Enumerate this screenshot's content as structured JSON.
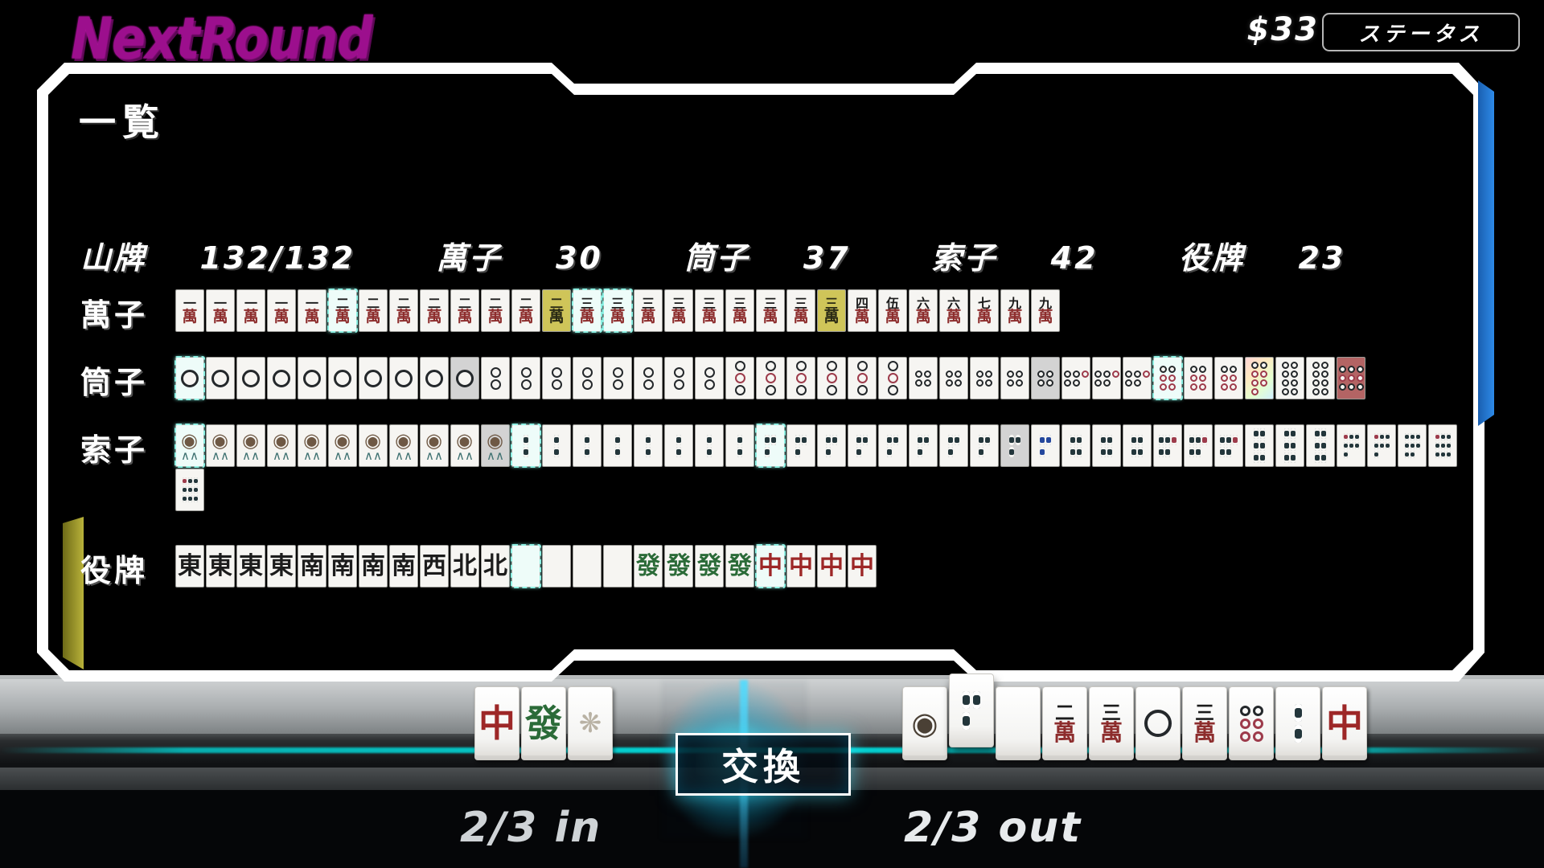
{
  "header": {
    "logo": "NextRound",
    "money": "$33",
    "status_button": "ステータス",
    "accent_magenta": "#9c0f8d"
  },
  "panel": {
    "title": "一覧",
    "counts": {
      "wall_label": "山牌",
      "wall_value": "132/132",
      "man_label": "萬子",
      "man_value": "30",
      "pin_label": "筒子",
      "pin_value": "37",
      "sou_label": "索子",
      "sou_value": "42",
      "honor_label": "役牌",
      "honor_value": "23"
    },
    "rows": [
      {
        "label": "萬子",
        "tiles": [
          {
            "k": "m",
            "n": "一",
            "hl": false,
            "bg": ""
          },
          {
            "k": "m",
            "n": "一",
            "hl": false,
            "bg": ""
          },
          {
            "k": "m",
            "n": "一",
            "hl": false,
            "bg": ""
          },
          {
            "k": "m",
            "n": "一",
            "hl": false,
            "bg": ""
          },
          {
            "k": "m",
            "n": "一",
            "hl": false,
            "bg": ""
          },
          {
            "k": "m",
            "n": "二",
            "hl": true,
            "bg": ""
          },
          {
            "k": "m",
            "n": "二",
            "hl": false,
            "bg": ""
          },
          {
            "k": "m",
            "n": "二",
            "hl": false,
            "bg": ""
          },
          {
            "k": "m",
            "n": "二",
            "hl": false,
            "bg": ""
          },
          {
            "k": "m",
            "n": "二",
            "hl": false,
            "bg": ""
          },
          {
            "k": "m",
            "n": "二",
            "hl": false,
            "bg": ""
          },
          {
            "k": "m",
            "n": "二",
            "hl": false,
            "bg": ""
          },
          {
            "k": "m",
            "n": "二",
            "hl": false,
            "bg": "yellow"
          },
          {
            "k": "m",
            "n": "三",
            "hl": true,
            "bg": ""
          },
          {
            "k": "m",
            "n": "三",
            "hl": true,
            "bg": ""
          },
          {
            "k": "m",
            "n": "三",
            "hl": false,
            "bg": ""
          },
          {
            "k": "m",
            "n": "三",
            "hl": false,
            "bg": ""
          },
          {
            "k": "m",
            "n": "三",
            "hl": false,
            "bg": ""
          },
          {
            "k": "m",
            "n": "三",
            "hl": false,
            "bg": ""
          },
          {
            "k": "m",
            "n": "三",
            "hl": false,
            "bg": ""
          },
          {
            "k": "m",
            "n": "三",
            "hl": false,
            "bg": ""
          },
          {
            "k": "m",
            "n": "三",
            "hl": false,
            "bg": "yellow"
          },
          {
            "k": "m",
            "n": "四",
            "hl": false,
            "bg": ""
          },
          {
            "k": "m",
            "n": "伍",
            "hl": false,
            "bg": ""
          },
          {
            "k": "m",
            "n": "六",
            "hl": false,
            "bg": ""
          },
          {
            "k": "m",
            "n": "六",
            "hl": false,
            "bg": ""
          },
          {
            "k": "m",
            "n": "七",
            "hl": false,
            "bg": ""
          },
          {
            "k": "m",
            "n": "九",
            "hl": false,
            "bg": ""
          },
          {
            "k": "m",
            "n": "九",
            "hl": false,
            "bg": ""
          }
        ]
      },
      {
        "label": "筒子",
        "tiles": [
          {
            "k": "p",
            "n": 1,
            "hl": true,
            "bg": ""
          },
          {
            "k": "p",
            "n": 1,
            "hl": false,
            "bg": ""
          },
          {
            "k": "p",
            "n": 1,
            "hl": false,
            "bg": ""
          },
          {
            "k": "p",
            "n": 1,
            "hl": false,
            "bg": ""
          },
          {
            "k": "p",
            "n": 1,
            "hl": false,
            "bg": ""
          },
          {
            "k": "p",
            "n": 1,
            "hl": false,
            "bg": ""
          },
          {
            "k": "p",
            "n": 1,
            "hl": false,
            "bg": ""
          },
          {
            "k": "p",
            "n": 1,
            "hl": false,
            "bg": ""
          },
          {
            "k": "p",
            "n": 1,
            "hl": false,
            "bg": ""
          },
          {
            "k": "p",
            "n": 1,
            "hl": false,
            "bg": "grey"
          },
          {
            "k": "p",
            "n": 2,
            "hl": false,
            "bg": ""
          },
          {
            "k": "p",
            "n": 2,
            "hl": false,
            "bg": ""
          },
          {
            "k": "p",
            "n": 2,
            "hl": false,
            "bg": ""
          },
          {
            "k": "p",
            "n": 2,
            "hl": false,
            "bg": ""
          },
          {
            "k": "p",
            "n": 2,
            "hl": false,
            "bg": ""
          },
          {
            "k": "p",
            "n": 2,
            "hl": false,
            "bg": ""
          },
          {
            "k": "p",
            "n": 2,
            "hl": false,
            "bg": ""
          },
          {
            "k": "p",
            "n": 2,
            "hl": false,
            "bg": ""
          },
          {
            "k": "p",
            "n": 3,
            "hl": false,
            "bg": ""
          },
          {
            "k": "p",
            "n": 3,
            "hl": false,
            "bg": ""
          },
          {
            "k": "p",
            "n": 3,
            "hl": false,
            "bg": ""
          },
          {
            "k": "p",
            "n": 3,
            "hl": false,
            "bg": ""
          },
          {
            "k": "p",
            "n": 3,
            "hl": false,
            "bg": ""
          },
          {
            "k": "p",
            "n": 3,
            "hl": false,
            "bg": ""
          },
          {
            "k": "p",
            "n": 4,
            "hl": false,
            "bg": ""
          },
          {
            "k": "p",
            "n": 4,
            "hl": false,
            "bg": ""
          },
          {
            "k": "p",
            "n": 4,
            "hl": false,
            "bg": ""
          },
          {
            "k": "p",
            "n": 4,
            "hl": false,
            "bg": ""
          },
          {
            "k": "p",
            "n": 4,
            "hl": false,
            "bg": "grey"
          },
          {
            "k": "p",
            "n": 5,
            "hl": false,
            "bg": ""
          },
          {
            "k": "p",
            "n": 5,
            "hl": false,
            "bg": ""
          },
          {
            "k": "p",
            "n": 5,
            "hl": false,
            "bg": ""
          },
          {
            "k": "p",
            "n": 6,
            "hl": true,
            "bg": ""
          },
          {
            "k": "p",
            "n": 6,
            "hl": false,
            "bg": ""
          },
          {
            "k": "p",
            "n": 6,
            "hl": false,
            "bg": ""
          },
          {
            "k": "p",
            "n": 7,
            "hl": false,
            "bg": "rainbow"
          },
          {
            "k": "p",
            "n": 8,
            "hl": false,
            "bg": ""
          },
          {
            "k": "p",
            "n": 8,
            "hl": false,
            "bg": ""
          },
          {
            "k": "p",
            "n": 9,
            "hl": false,
            "bg": "red"
          }
        ]
      },
      {
        "label": "索子",
        "tiles": [
          {
            "k": "s",
            "n": 1,
            "hl": true,
            "bg": ""
          },
          {
            "k": "s",
            "n": 1,
            "hl": false,
            "bg": ""
          },
          {
            "k": "s",
            "n": 1,
            "hl": false,
            "bg": ""
          },
          {
            "k": "s",
            "n": 1,
            "hl": false,
            "bg": ""
          },
          {
            "k": "s",
            "n": 1,
            "hl": false,
            "bg": ""
          },
          {
            "k": "s",
            "n": 1,
            "hl": false,
            "bg": ""
          },
          {
            "k": "s",
            "n": 1,
            "hl": false,
            "bg": ""
          },
          {
            "k": "s",
            "n": 1,
            "hl": false,
            "bg": ""
          },
          {
            "k": "s",
            "n": 1,
            "hl": false,
            "bg": ""
          },
          {
            "k": "s",
            "n": 1,
            "hl": false,
            "bg": ""
          },
          {
            "k": "s",
            "n": 1,
            "hl": false,
            "bg": "grey"
          },
          {
            "k": "s",
            "n": 2,
            "hl": true,
            "bg": ""
          },
          {
            "k": "s",
            "n": 2,
            "hl": false,
            "bg": ""
          },
          {
            "k": "s",
            "n": 2,
            "hl": false,
            "bg": ""
          },
          {
            "k": "s",
            "n": 2,
            "hl": false,
            "bg": ""
          },
          {
            "k": "s",
            "n": 2,
            "hl": false,
            "bg": ""
          },
          {
            "k": "s",
            "n": 2,
            "hl": false,
            "bg": ""
          },
          {
            "k": "s",
            "n": 2,
            "hl": false,
            "bg": ""
          },
          {
            "k": "s",
            "n": 2,
            "hl": false,
            "bg": ""
          },
          {
            "k": "s",
            "n": 3,
            "hl": true,
            "bg": ""
          },
          {
            "k": "s",
            "n": 3,
            "hl": false,
            "bg": ""
          },
          {
            "k": "s",
            "n": 3,
            "hl": false,
            "bg": ""
          },
          {
            "k": "s",
            "n": 3,
            "hl": false,
            "bg": ""
          },
          {
            "k": "s",
            "n": 3,
            "hl": false,
            "bg": ""
          },
          {
            "k": "s",
            "n": 3,
            "hl": false,
            "bg": ""
          },
          {
            "k": "s",
            "n": 3,
            "hl": false,
            "bg": ""
          },
          {
            "k": "s",
            "n": 3,
            "hl": false,
            "bg": ""
          },
          {
            "k": "s",
            "n": 3,
            "hl": false,
            "bg": "grey"
          },
          {
            "k": "s",
            "n": 3,
            "hl": false,
            "bg": "blue"
          },
          {
            "k": "s",
            "n": 4,
            "hl": false,
            "bg": ""
          },
          {
            "k": "s",
            "n": 4,
            "hl": false,
            "bg": ""
          },
          {
            "k": "s",
            "n": 4,
            "hl": false,
            "bg": ""
          },
          {
            "k": "s",
            "n": 5,
            "hl": false,
            "bg": ""
          },
          {
            "k": "s",
            "n": 5,
            "hl": false,
            "bg": ""
          },
          {
            "k": "s",
            "n": 5,
            "hl": false,
            "bg": ""
          },
          {
            "k": "s",
            "n": 6,
            "hl": false,
            "bg": ""
          },
          {
            "k": "s",
            "n": 6,
            "hl": false,
            "bg": ""
          },
          {
            "k": "s",
            "n": 6,
            "hl": false,
            "bg": ""
          },
          {
            "k": "s",
            "n": 7,
            "hl": false,
            "bg": ""
          },
          {
            "k": "s",
            "n": 7,
            "hl": false,
            "bg": ""
          },
          {
            "k": "s",
            "n": 8,
            "hl": false,
            "bg": ""
          },
          {
            "k": "s",
            "n": 9,
            "hl": false,
            "bg": ""
          },
          {
            "k": "s",
            "n": 9,
            "hl": false,
            "bg": ""
          }
        ]
      },
      {
        "label": "役牌",
        "tiles": [
          {
            "k": "h",
            "n": "東",
            "hl": false,
            "bg": ""
          },
          {
            "k": "h",
            "n": "東",
            "hl": false,
            "bg": ""
          },
          {
            "k": "h",
            "n": "東",
            "hl": false,
            "bg": ""
          },
          {
            "k": "h",
            "n": "東",
            "hl": false,
            "bg": ""
          },
          {
            "k": "h",
            "n": "南",
            "hl": false,
            "bg": ""
          },
          {
            "k": "h",
            "n": "南",
            "hl": false,
            "bg": ""
          },
          {
            "k": "h",
            "n": "南",
            "hl": false,
            "bg": ""
          },
          {
            "k": "h",
            "n": "南",
            "hl": false,
            "bg": ""
          },
          {
            "k": "h",
            "n": "西",
            "hl": false,
            "bg": ""
          },
          {
            "k": "h",
            "n": "北",
            "hl": false,
            "bg": ""
          },
          {
            "k": "h",
            "n": "北",
            "hl": false,
            "bg": ""
          },
          {
            "k": "h",
            "n": "",
            "hl": true,
            "bg": ""
          },
          {
            "k": "h",
            "n": "",
            "hl": false,
            "bg": ""
          },
          {
            "k": "h",
            "n": "",
            "hl": false,
            "bg": ""
          },
          {
            "k": "h",
            "n": "",
            "hl": false,
            "bg": ""
          },
          {
            "k": "h",
            "n": "發",
            "hl": false,
            "bg": ""
          },
          {
            "k": "h",
            "n": "發",
            "hl": false,
            "bg": ""
          },
          {
            "k": "h",
            "n": "發",
            "hl": false,
            "bg": ""
          },
          {
            "k": "h",
            "n": "發",
            "hl": false,
            "bg": ""
          },
          {
            "k": "h",
            "n": "中",
            "hl": true,
            "bg": ""
          },
          {
            "k": "h",
            "n": "中",
            "hl": false,
            "bg": ""
          },
          {
            "k": "h",
            "n": "中",
            "hl": false,
            "bg": ""
          },
          {
            "k": "h",
            "n": "中",
            "hl": false,
            "bg": ""
          }
        ]
      }
    ]
  },
  "hand": {
    "in_count": "2/3 in",
    "out_count": "2/3 out",
    "swap_button": "交換",
    "left_tiles": [
      {
        "k": "h",
        "n": "中",
        "raised": false
      },
      {
        "k": "h",
        "n": "發",
        "raised": false
      },
      {
        "k": "f",
        "n": "花",
        "raised": false
      }
    ],
    "right_tiles": [
      {
        "k": "s",
        "n": 1,
        "raised": false
      },
      {
        "k": "s",
        "n": 3,
        "raised": true
      },
      {
        "k": "h",
        "n": "",
        "raised": false
      },
      {
        "k": "m",
        "n": "二",
        "raised": false
      },
      {
        "k": "m",
        "n": "三",
        "raised": false
      },
      {
        "k": "p",
        "n": 1,
        "raised": false
      },
      {
        "k": "m",
        "n": "三",
        "raised": false
      },
      {
        "k": "p",
        "n": 6,
        "raised": false
      },
      {
        "k": "s",
        "n": 2,
        "raised": false
      },
      {
        "k": "h",
        "n": "中",
        "raised": false
      }
    ]
  },
  "colors": {
    "frame": "#ffffff",
    "panel_bg": "#000000",
    "accent_cyan": "#8ff1e4",
    "accent_yellow": "#b9b23a",
    "accent_blue": "#2d8ae8",
    "tile_face": "#f6f5f2",
    "man_red": "#8d2d2d"
  }
}
